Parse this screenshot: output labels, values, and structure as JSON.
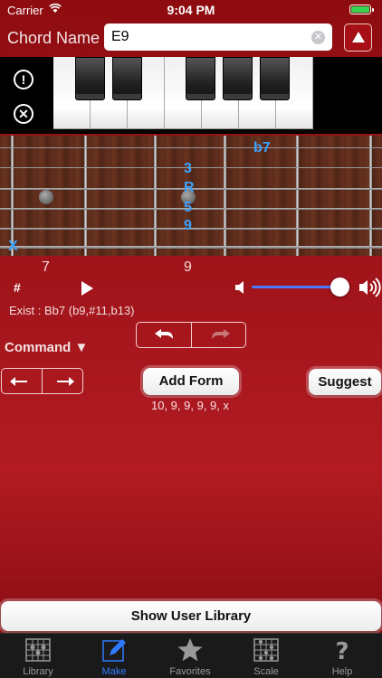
{
  "status_bar": {
    "carrier": "Carrier",
    "time": "9:04 PM"
  },
  "header": {
    "chord_label": "Chord Name",
    "chord_value": "E9"
  },
  "fretboard": {
    "fret_numbers": [
      "7",
      "9"
    ],
    "muted_marker": "X",
    "notes": [
      "b7",
      "3",
      "R",
      "5",
      "9"
    ]
  },
  "playback": {
    "sharp_label": "#",
    "volume_level": 0.9
  },
  "exist_text": "Exist : Bb7 (b9,#11,b13)",
  "command_label": "Command ▼",
  "buttons": {
    "add_form": "Add Form",
    "suggest": "Suggest",
    "show_user_library": "Show User Library"
  },
  "form_text": "10, 9, 9, 9, 9, x",
  "tabs": [
    {
      "label": "Library",
      "icon": "chord-grid-icon"
    },
    {
      "label": "Make",
      "icon": "pencil-icon"
    },
    {
      "label": "Favorites",
      "icon": "star-icon"
    },
    {
      "label": "Scale",
      "icon": "scale-grid-icon"
    },
    {
      "label": "Help",
      "icon": "question-icon"
    }
  ],
  "colors": {
    "accent": "#2f7bff",
    "note_label": "#3ba3ff",
    "background": "#a0141a"
  }
}
